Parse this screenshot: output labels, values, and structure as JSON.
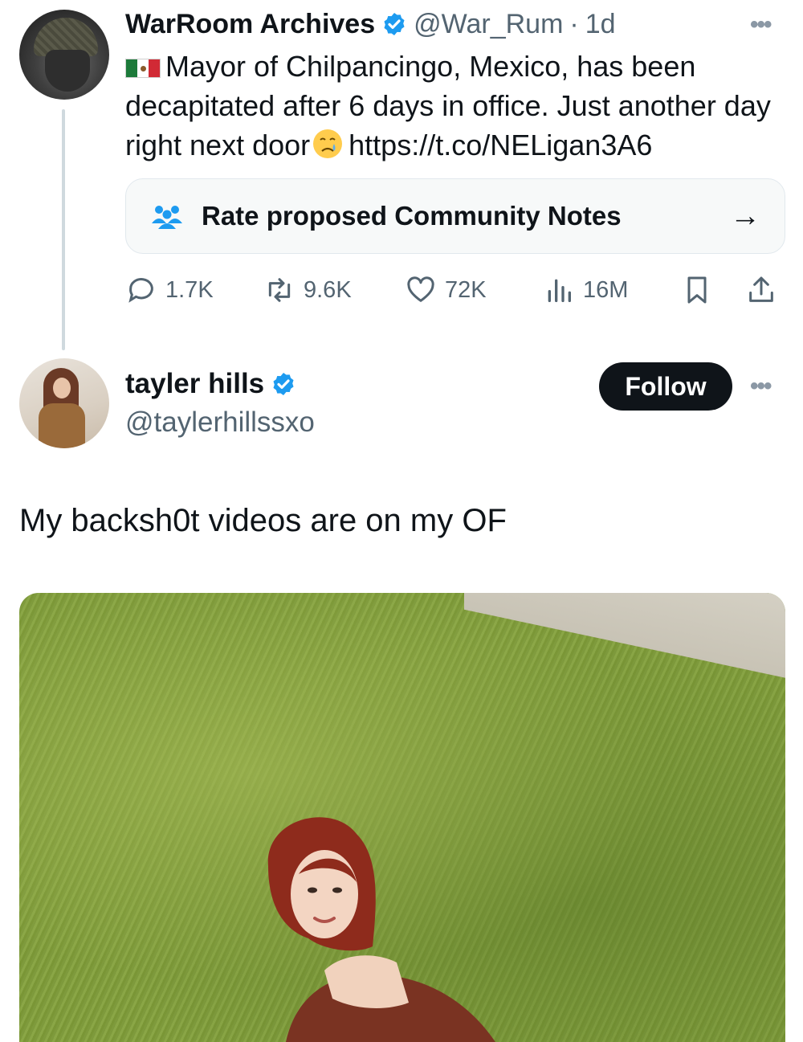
{
  "tweet1": {
    "author_name": "WarRoom Archives",
    "handle": "@War_Rum",
    "separator": "·",
    "time": "1d",
    "text": "Mayor of Chilpancingo, Mexico, has been decapitated after 6 days in office. Just another day right next door",
    "link": "https://t.co/NELigan3A6",
    "flag_icon": "mexico-flag-icon",
    "emoji_icon": "crying-face-icon",
    "community_notes_label": "Rate proposed Community Notes",
    "stats": {
      "replies": "1.7K",
      "reposts": "9.6K",
      "likes": "72K",
      "views": "16M"
    }
  },
  "tweet2": {
    "author_name": "tayler hills",
    "handle": "@taylerhillssxo",
    "follow_label": "Follow",
    "text": "My backsh0t videos are on my OF"
  },
  "colors": {
    "verified": "#1d9bf0",
    "text_primary": "#0f1419",
    "text_secondary": "#536471",
    "follow_bg": "#0f1419"
  }
}
